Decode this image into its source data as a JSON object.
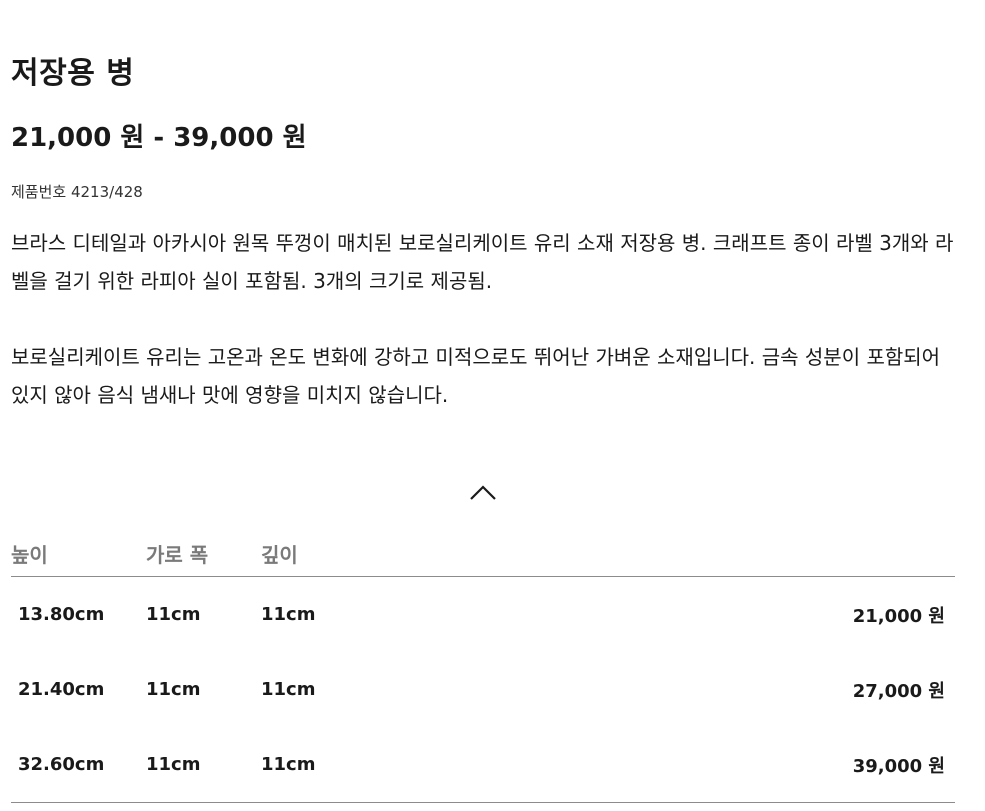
{
  "product": {
    "title": "저장용 병",
    "price_range": "21,000 원 - 39,000 원",
    "sku": "제품번호 4213/428",
    "description": "브라스 디테일과 아카시아 원목 뚜껑이 매치된 보로실리케이트 유리 소재 저장용 병. 크래프트 종이 라벨 3개와 라벨을 걸기 위한 라피아 실이 포함됨. 3개의 크기로 제공됨.\n\n보로실리케이트 유리는 고온과 온도 변화에 강하고 미적으로도 뛰어난 가벼운 소재입니다. 금속 성분이 포함되어 있지 않아 음식 냄새나 맛에 영향을 미치지 않습니다."
  },
  "collapse_icon": "chevron-up-icon",
  "size_table": {
    "headers": [
      "높이",
      "가로 폭",
      "깊이",
      ""
    ],
    "rows": [
      {
        "height": "13.80cm",
        "width": "11cm",
        "depth": "11cm",
        "price": "21,000 원"
      },
      {
        "height": "21.40cm",
        "width": "11cm",
        "depth": "11cm",
        "price": "27,000 원"
      },
      {
        "height": "32.60cm",
        "width": "11cm",
        "depth": "11cm",
        "price": "39,000 원"
      }
    ]
  }
}
